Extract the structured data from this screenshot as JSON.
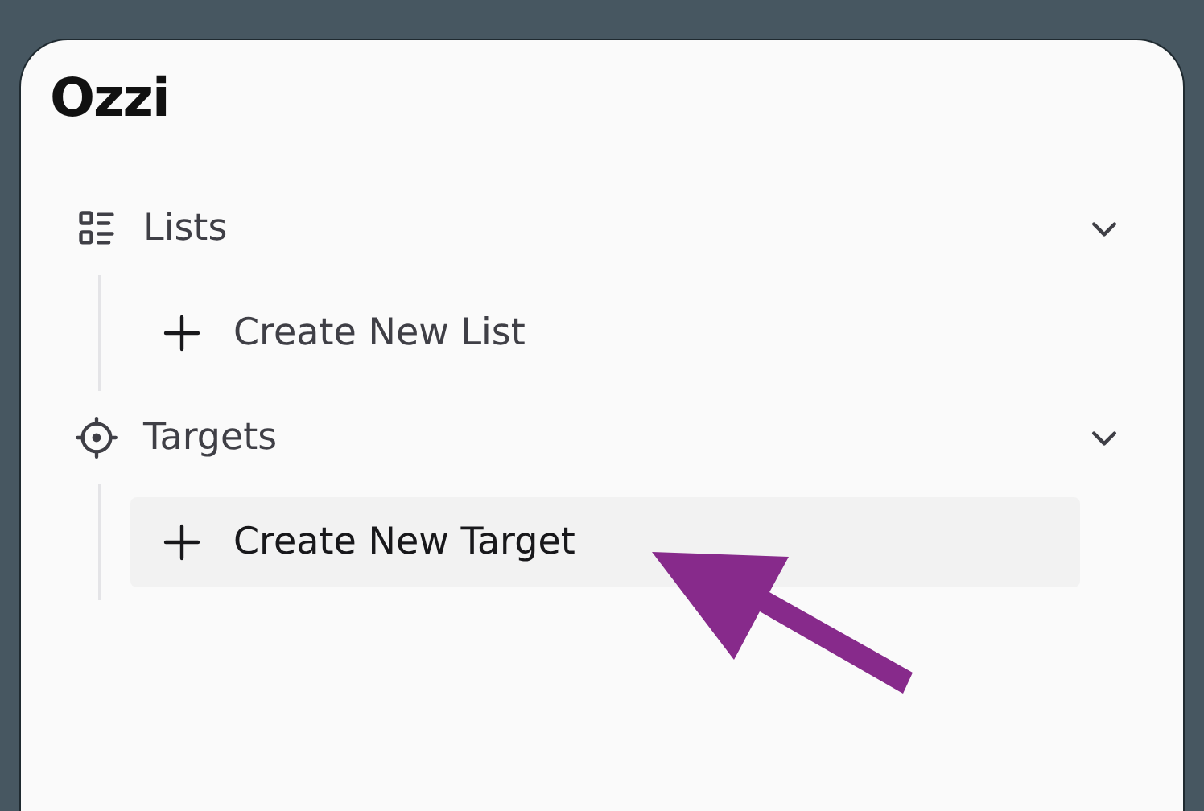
{
  "logo": "Ozzi",
  "sections": [
    {
      "label": "Lists",
      "kind": "list",
      "expanded": true,
      "children": [
        {
          "label": "Create New List",
          "selected": false
        }
      ]
    },
    {
      "label": "Targets",
      "kind": "target",
      "expanded": true,
      "children": [
        {
          "label": "Create New Target",
          "selected": true
        }
      ]
    }
  ]
}
